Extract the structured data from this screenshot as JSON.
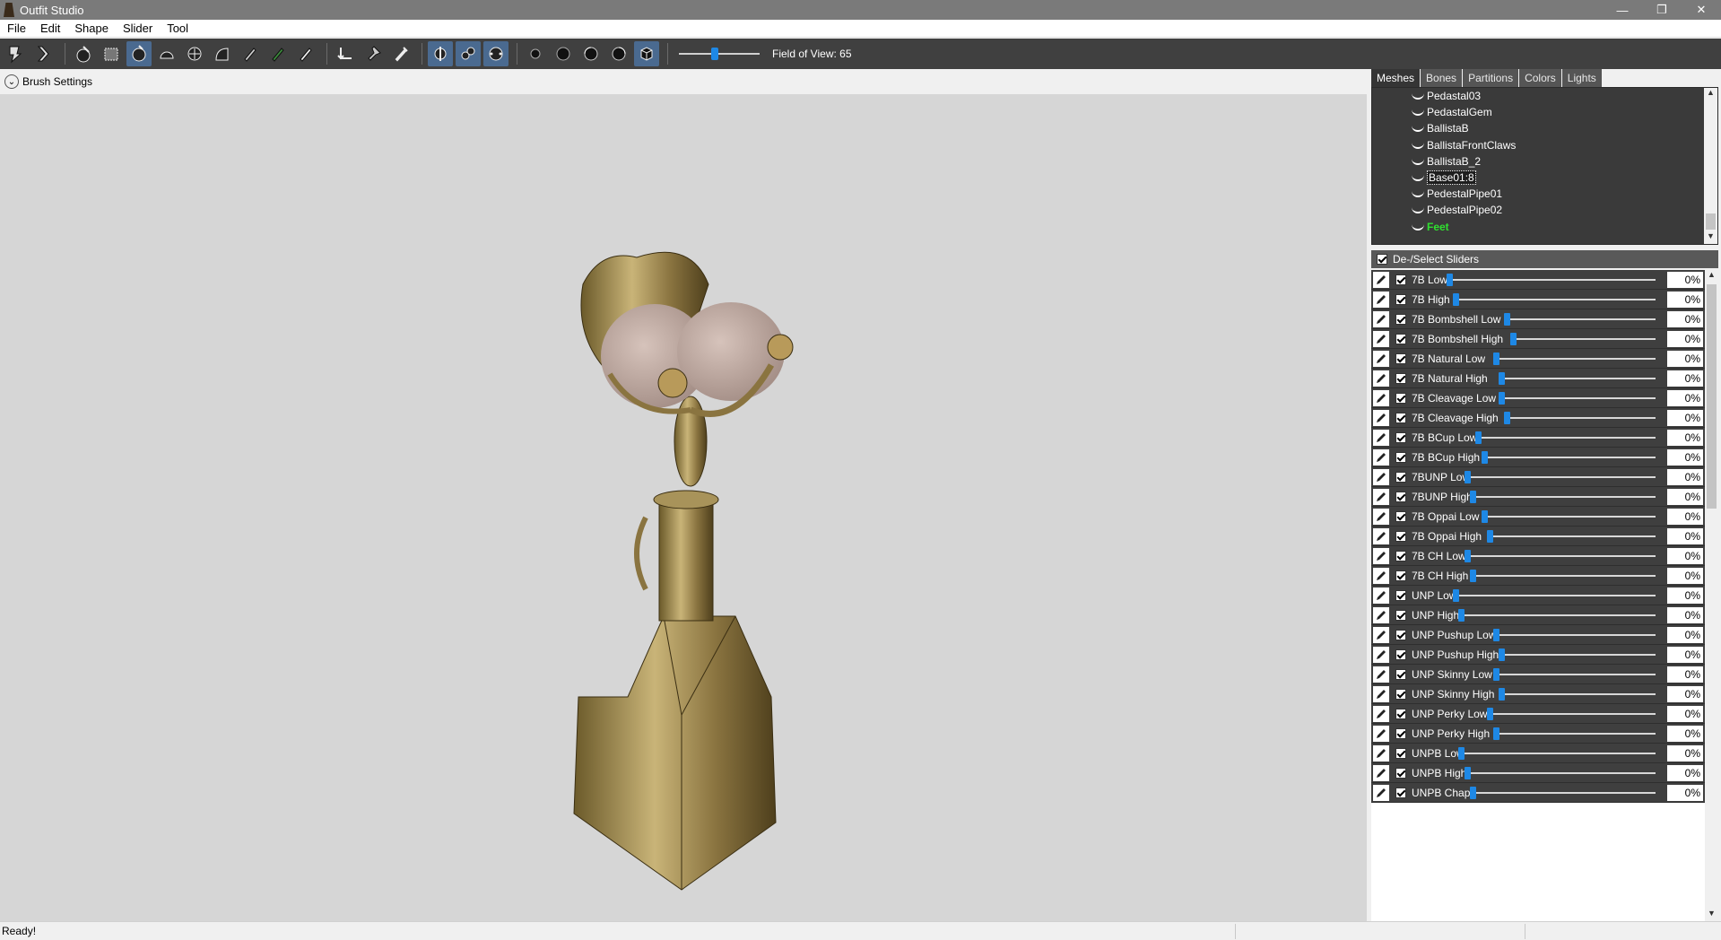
{
  "window": {
    "title": "Outfit Studio",
    "minimize_glyph": "—",
    "restore_glyph": "❐",
    "close_glyph": "✕"
  },
  "menu": [
    "File",
    "Edit",
    "Shape",
    "Slider",
    "Tool"
  ],
  "toolbar": {
    "icons": [
      "select-tool-icon",
      "transform-tool-icon",
      "standard-brush-icon",
      "mask-brush-icon",
      "inflate-brush-icon",
      "deflate-brush-icon",
      "move-brush-icon",
      "smooth-brush-icon",
      "undiff-brush-icon",
      "weight-brush-icon",
      "color-brush-icon",
      "alpha-brush-icon",
      "collision-brush-icon",
      "pivot-icon",
      "anchor-icon",
      "eyedropper-icon",
      "x-mirror-icon",
      "connected-only-icon",
      "global-brush-icon",
      "brush-size-small-icon",
      "brush-size-medium-icon",
      "brush-size-large-icon",
      "brush-size-xl-icon",
      "shade-mode-icon"
    ],
    "fov_value": 65,
    "fov_label": "Field of View: 65"
  },
  "brush_settings": {
    "expander_glyph": "⌄",
    "label": "Brush Settings"
  },
  "tabs": [
    "Meshes",
    "Bones",
    "Partitions",
    "Colors",
    "Lights"
  ],
  "active_tab": "Meshes",
  "meshes": [
    {
      "name": "Pedastal03",
      "state": "normal"
    },
    {
      "name": "PedastalGem",
      "state": "normal"
    },
    {
      "name": "BallistaB",
      "state": "normal"
    },
    {
      "name": "BallistaFrontClaws",
      "state": "normal"
    },
    {
      "name": "BallistaB_2",
      "state": "normal"
    },
    {
      "name": "Base01:8",
      "state": "selected"
    },
    {
      "name": "PedestalPipe01",
      "state": "normal"
    },
    {
      "name": "PedestalPipe02",
      "state": "normal"
    },
    {
      "name": "Feet",
      "state": "green"
    }
  ],
  "scroll_up_glyph": "▲",
  "scroll_down_glyph": "▼",
  "sliders_header": "De-/Select Sliders",
  "sliders": [
    {
      "name": "7B Low",
      "value": "0%",
      "level": 0
    },
    {
      "name": "7B High",
      "value": "0%",
      "level": 0
    },
    {
      "name": "7B Bombshell Low",
      "value": "0%",
      "level": 0
    },
    {
      "name": "7B Bombshell High",
      "value": "0%",
      "level": 0
    },
    {
      "name": "7B Natural Low",
      "value": "0%",
      "level": 0
    },
    {
      "name": "7B Natural High",
      "value": "0%",
      "level": 0
    },
    {
      "name": "7B Cleavage Low",
      "value": "0%",
      "level": 0
    },
    {
      "name": "7B Cleavage High",
      "value": "0%",
      "level": 0
    },
    {
      "name": "7B BCup Low",
      "value": "0%",
      "level": 0
    },
    {
      "name": "7B BCup High",
      "value": "0%",
      "level": 0
    },
    {
      "name": "7BUNP Low",
      "value": "0%",
      "level": 0
    },
    {
      "name": "7BUNP High",
      "value": "0%",
      "level": 0
    },
    {
      "name": "7B Oppai Low",
      "value": "0%",
      "level": 0
    },
    {
      "name": "7B Oppai High",
      "value": "0%",
      "level": 0
    },
    {
      "name": "7B CH Low",
      "value": "0%",
      "level": 0
    },
    {
      "name": "7B CH High",
      "value": "0%",
      "level": 0
    },
    {
      "name": "UNP Low",
      "value": "0%",
      "level": 0
    },
    {
      "name": "UNP High",
      "value": "0%",
      "level": 0
    },
    {
      "name": "UNP Pushup Low",
      "value": "0%",
      "level": 0
    },
    {
      "name": "UNP Pushup High",
      "value": "0%",
      "level": 0
    },
    {
      "name": "UNP Skinny Low",
      "value": "0%",
      "level": 0
    },
    {
      "name": "UNP Skinny High",
      "value": "0%",
      "level": 0
    },
    {
      "name": "UNP Perky Low",
      "value": "0%",
      "level": 0
    },
    {
      "name": "UNP Perky High",
      "value": "0%",
      "level": 0
    },
    {
      "name": "UNPB Low",
      "value": "0%",
      "level": 0
    },
    {
      "name": "UNPB High",
      "value": "0%",
      "level": 0
    },
    {
      "name": "UNPB Chapi",
      "value": "0%",
      "level": 0
    }
  ],
  "status": "Ready!",
  "colors": {
    "accent": "#1e88e5",
    "toolbar_bg": "#404040",
    "viewport_bg": "#d6d6d6",
    "mesh_green": "#2fe02f"
  }
}
